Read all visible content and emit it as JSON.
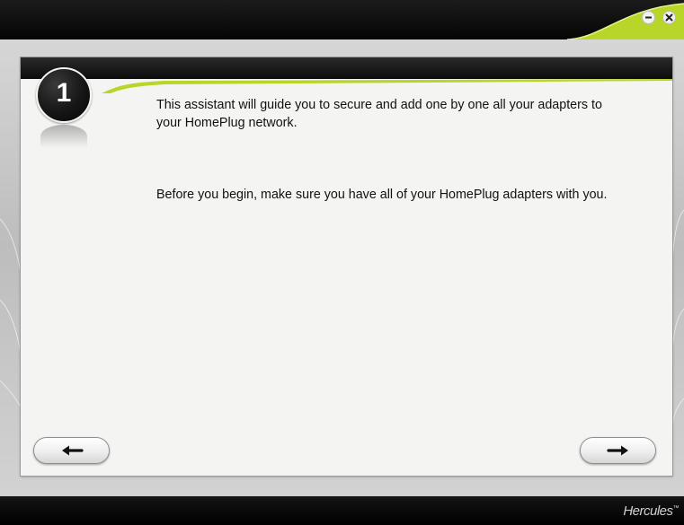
{
  "window": {
    "brand": "Hercules",
    "brand_mark": "™",
    "minimize_icon": "minimize-icon",
    "close_icon": "close-icon",
    "accent_color": "#b8d62a"
  },
  "step": {
    "number": "1"
  },
  "content": {
    "paragraph1": "This assistant will guide you to secure and add one by one all your adapters to your HomePlug network.",
    "paragraph2": "Before you begin, make sure you have all of your HomePlug adapters with you."
  },
  "navigation": {
    "back_icon": "arrow-left-icon",
    "next_icon": "arrow-right-icon"
  }
}
